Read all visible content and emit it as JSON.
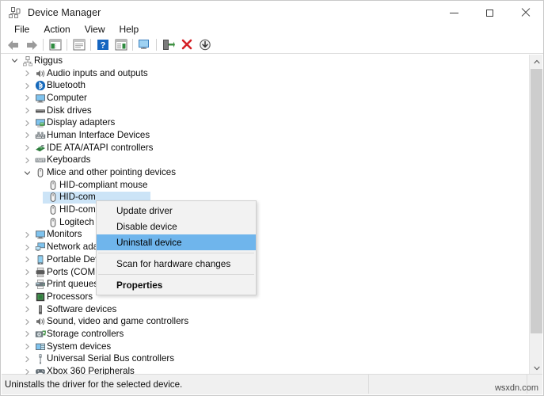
{
  "window": {
    "title": "Device Manager",
    "title_icon": "device-manager-icon",
    "controls": {
      "minimize": "minimize-button",
      "maximize": "maximize-button",
      "close": "close-button"
    }
  },
  "menubar": {
    "items": [
      {
        "label": "File"
      },
      {
        "label": "Action"
      },
      {
        "label": "View"
      },
      {
        "label": "Help"
      }
    ]
  },
  "toolbar": {
    "buttons": [
      {
        "name": "back-icon",
        "tooltip": "Back"
      },
      {
        "name": "forward-icon",
        "tooltip": "Forward"
      },
      {
        "name": "show-hide-console-tree-icon",
        "tooltip": "Show/Hide Console Tree"
      },
      {
        "name": "properties-icon",
        "tooltip": "Properties"
      },
      {
        "name": "help-icon",
        "tooltip": "Help"
      },
      {
        "name": "show-hide-action-pane-icon",
        "tooltip": "Show/Hide Action Pane"
      },
      {
        "name": "scan-for-hardware-changes-icon",
        "tooltip": "Scan for hardware changes"
      },
      {
        "name": "update-driver-icon",
        "tooltip": "Update driver"
      },
      {
        "name": "uninstall-device-icon",
        "tooltip": "Uninstall device"
      },
      {
        "name": "disable-device-icon",
        "tooltip": "Disable device"
      }
    ]
  },
  "tree": {
    "root": {
      "label": "Riggus",
      "icon": "computer-node-icon",
      "expanded": true
    },
    "nodes": [
      {
        "label": "Audio inputs and outputs",
        "icon": "speaker-icon",
        "expanded": false,
        "depth": 1
      },
      {
        "label": "Bluetooth",
        "icon": "bluetooth-icon",
        "expanded": false,
        "depth": 1
      },
      {
        "label": "Computer",
        "icon": "monitor-icon",
        "expanded": false,
        "depth": 1
      },
      {
        "label": "Disk drives",
        "icon": "disk-drive-icon",
        "expanded": false,
        "depth": 1
      },
      {
        "label": "Display adapters",
        "icon": "display-adapter-icon",
        "expanded": false,
        "depth": 1
      },
      {
        "label": "Human Interface Devices",
        "icon": "hid-icon",
        "expanded": false,
        "depth": 1
      },
      {
        "label": "IDE ATA/ATAPI controllers",
        "icon": "ide-controller-icon",
        "expanded": false,
        "depth": 1
      },
      {
        "label": "Keyboards",
        "icon": "keyboard-icon",
        "expanded": false,
        "depth": 1
      },
      {
        "label": "Mice and other pointing devices",
        "icon": "mouse-icon",
        "expanded": true,
        "depth": 1
      },
      {
        "label": "HID-compliant mouse",
        "icon": "mouse-icon",
        "leaf": true,
        "depth": 2
      },
      {
        "label": "HID-com",
        "icon": "mouse-icon",
        "leaf": true,
        "depth": 2,
        "selected": true
      },
      {
        "label": "HID-com",
        "icon": "mouse-icon",
        "leaf": true,
        "depth": 2
      },
      {
        "label": "Logitech",
        "icon": "mouse-icon",
        "leaf": true,
        "depth": 2
      },
      {
        "label": "Monitors",
        "icon": "monitor-icon",
        "expanded": false,
        "depth": 1
      },
      {
        "label": "Network ada",
        "icon": "network-adapter-icon",
        "expanded": false,
        "depth": 1
      },
      {
        "label": "Portable Dev",
        "icon": "portable-device-icon",
        "expanded": false,
        "depth": 1
      },
      {
        "label": "Ports (COM &",
        "icon": "ports-icon",
        "expanded": false,
        "depth": 1
      },
      {
        "label": "Print queues",
        "icon": "printer-icon",
        "expanded": false,
        "depth": 1
      },
      {
        "label": "Processors",
        "icon": "processor-icon",
        "expanded": false,
        "depth": 1
      },
      {
        "label": "Software devices",
        "icon": "software-device-icon",
        "expanded": false,
        "depth": 1
      },
      {
        "label": "Sound, video and game controllers",
        "icon": "speaker-icon",
        "expanded": false,
        "depth": 1
      },
      {
        "label": "Storage controllers",
        "icon": "storage-controller-icon",
        "expanded": false,
        "depth": 1
      },
      {
        "label": "System devices",
        "icon": "system-device-icon",
        "expanded": false,
        "depth": 1
      },
      {
        "label": "Universal Serial Bus controllers",
        "icon": "usb-icon",
        "expanded": false,
        "depth": 1
      },
      {
        "label": "Xbox 360 Peripherals",
        "icon": "xbox-icon",
        "expanded": false,
        "depth": 1
      }
    ]
  },
  "context_menu": {
    "items": [
      {
        "label": "Update driver",
        "highlighted": false,
        "bold": false
      },
      {
        "label": "Disable device",
        "highlighted": false,
        "bold": false
      },
      {
        "label": "Uninstall device",
        "highlighted": true,
        "bold": false
      },
      {
        "separator": true
      },
      {
        "label": "Scan for hardware changes",
        "highlighted": false,
        "bold": false
      },
      {
        "separator": true
      },
      {
        "label": "Properties",
        "highlighted": false,
        "bold": true
      }
    ]
  },
  "statusbar": {
    "text": "Uninstalls the driver for the selected device."
  },
  "watermark": {
    "text": "wsxdn.com"
  },
  "colors": {
    "selection": "#cce4f7",
    "menu_highlight": "#6fb5ec",
    "accent_red": "#d42026",
    "accent_blue": "#0a64ad",
    "accent_green": "#3f9142"
  }
}
